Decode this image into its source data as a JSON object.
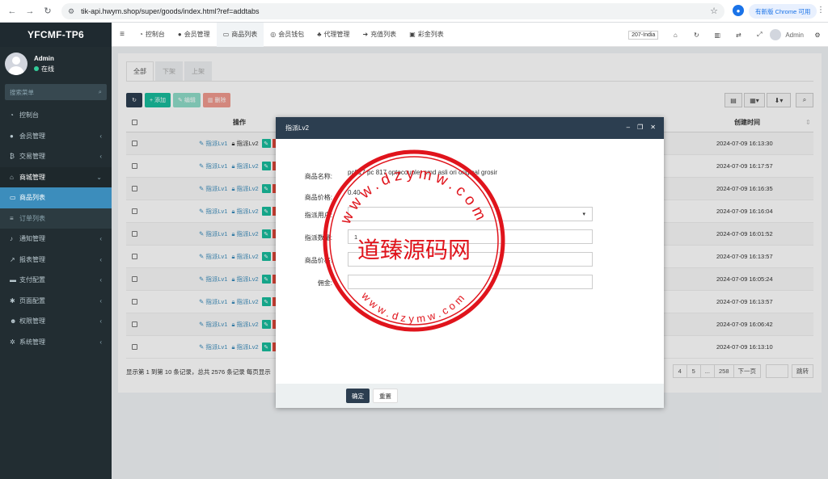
{
  "browser": {
    "url": "tik-api.hwym.shop/super/goods/index.html?ref=addtabs",
    "update_label": "有新版 Chrome 可用"
  },
  "sidebar": {
    "brand": "YFCMF-TP6",
    "user": {
      "name": "Admin",
      "status": "在线"
    },
    "search_placeholder": "搜索菜单",
    "items": [
      {
        "label": "控制台",
        "icon": "dashboard-icon"
      },
      {
        "label": "会员管理",
        "icon": "user-icon"
      },
      {
        "label": "交易管理",
        "icon": "bitcoin-icon"
      },
      {
        "label": "商城管理",
        "icon": "home-icon"
      },
      {
        "label": "商品列表",
        "icon": "monitor-icon"
      },
      {
        "label": "订单列表",
        "icon": "list-icon"
      },
      {
        "label": "通知管理",
        "icon": "bell-icon"
      },
      {
        "label": "报表管理",
        "icon": "chart-icon"
      },
      {
        "label": "支付配置",
        "icon": "card-icon"
      },
      {
        "label": "页面配置",
        "icon": "gear-icon"
      },
      {
        "label": "权限管理",
        "icon": "users-icon"
      },
      {
        "label": "系统管理",
        "icon": "cogs-icon"
      }
    ]
  },
  "topnav": {
    "tabs": [
      {
        "label": "控制台"
      },
      {
        "label": "会员管理"
      },
      {
        "label": "商品列表"
      },
      {
        "label": "会员钱包"
      },
      {
        "label": "代理管理"
      },
      {
        "label": "充值列表"
      },
      {
        "label": "彩金列表"
      }
    ],
    "lang": "207-India",
    "admin": "Admin"
  },
  "panel": {
    "tabs": [
      "全部",
      "下架",
      "上架"
    ],
    "toolbar": {
      "add": "添加",
      "edit": "编辑",
      "delete": "删除"
    },
    "columns": {
      "operation": "操作",
      "created": "创建时间"
    },
    "action_lv1": "指派Lv1",
    "action_lv2": "指派Lv2",
    "rows": [
      {
        "time": "2024-07-09 16:13:30"
      },
      {
        "time": "2024-07-09 16:17:57"
      },
      {
        "time": "2024-07-09 16:16:35"
      },
      {
        "time": "2024-07-09 16:16:04"
      },
      {
        "time": "2024-07-09 16:01:52"
      },
      {
        "time": "2024-07-09 16:13:57"
      },
      {
        "time": "2024-07-09 16:05:24"
      },
      {
        "time": "2024-07-09 16:13:57"
      },
      {
        "time": "2024-07-09 16:06:42"
      },
      {
        "time": "2024-07-09 16:13:10"
      }
    ],
    "footer": "显示第 1 到第 10 条记录，总共 2576 条记录 每页显示",
    "pager": {
      "p4": "4",
      "p5": "5",
      "ellipsis": "...",
      "last": "258",
      "next": "下一页",
      "jump": "跳转"
    }
  },
  "modal": {
    "title": "指派Lv2",
    "fields": {
      "name_label": "商品名称:",
      "name_value": "pc817 pc 817 optocoupler smd asli ori original grosir",
      "price_label": "商品价格:",
      "price_value": "0.40",
      "user_label": "指派用户:",
      "count_label": "指派数量:",
      "count_value": "1",
      "goods_price_label": "商品价格:",
      "commission_label": "佣金:"
    },
    "ok": "确定",
    "reset": "重置"
  },
  "stamp": {
    "top_text": "www.dzymw.com",
    "center_text": "道臻源码网",
    "bottom_text": "www.dzymw.com",
    "color": "#e0141c"
  }
}
